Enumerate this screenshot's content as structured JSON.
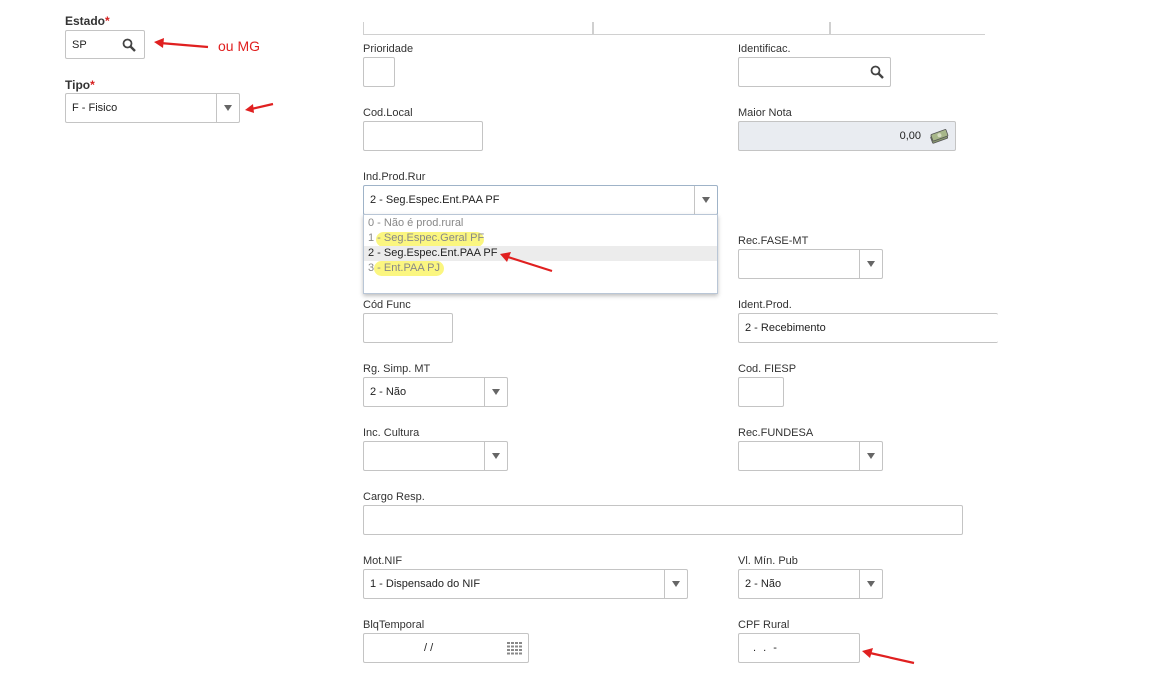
{
  "left": {
    "estado": {
      "label": "Estado",
      "required": "*",
      "value": "SP",
      "annotation": "ou MG"
    },
    "tipo": {
      "label": "Tipo",
      "required": "*",
      "value": "F - Fisico"
    }
  },
  "form": {
    "prioridade": {
      "label": "Prioridade",
      "value": ""
    },
    "identificac": {
      "label": "Identificac.",
      "value": ""
    },
    "cod_local": {
      "label": "Cod.Local",
      "value": ""
    },
    "maior_nota": {
      "label": "Maior Nota",
      "value": "0,00"
    },
    "ind_prod_rur": {
      "label": "Ind.Prod.Rur",
      "value": "2 - Seg.Espec.Ent.PAA PF",
      "options": [
        "0 - Não é prod.rural",
        "1 - Seg.Espec.Geral PF",
        "2 - Seg.Espec.Ent.PAA PF",
        "3 - Ent.PAA PJ"
      ],
      "selected_index": 2
    },
    "rec_fase_mt": {
      "label": "Rec.FASE-MT",
      "value": ""
    },
    "cod_func": {
      "label": "Cód Func",
      "value": ""
    },
    "ident_prod": {
      "label": "Ident.Prod.",
      "value": "2 - Recebimento"
    },
    "rg_simp_mt": {
      "label": "Rg. Simp. MT",
      "value": "2 - Não"
    },
    "cod_fiesp": {
      "label": "Cod. FIESP",
      "value": ""
    },
    "inc_cultura": {
      "label": "Inc. Cultura",
      "value": ""
    },
    "rec_fundesa": {
      "label": "Rec.FUNDESA",
      "value": ""
    },
    "cargo_resp": {
      "label": "Cargo Resp.",
      "value": ""
    },
    "mot_nif": {
      "label": "Mot.NIF",
      "value": "1 - Dispensado do NIF"
    },
    "vl_min_pub": {
      "label": "Vl. Mín. Pub",
      "value": "2 - Não"
    },
    "blq_temporal": {
      "label": "BlqTemporal",
      "value": "/ /"
    },
    "cpf_rural": {
      "label": "CPF Rural",
      "value": ". . -"
    }
  },
  "colors": {
    "arrow": "#e02020",
    "highlight": "#faf56a",
    "readonly_bg": "#e9ecf1",
    "border": "#c4c4c4"
  },
  "icons": [
    "search-icon",
    "chevron-down-icon",
    "money-icon",
    "calendar-icon",
    "arrow-annotation"
  ]
}
